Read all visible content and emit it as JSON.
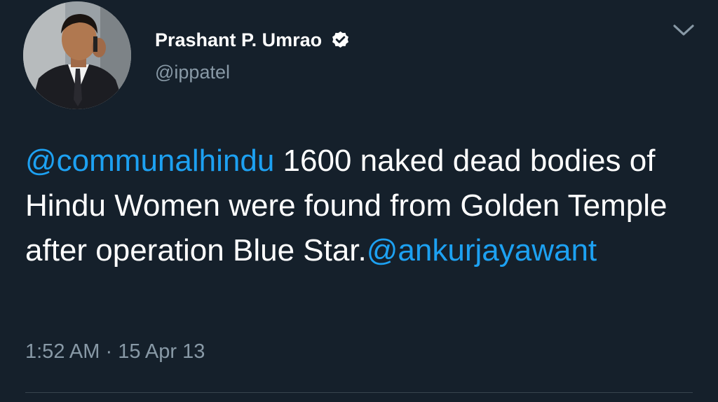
{
  "tweet": {
    "author": {
      "display_name": "Prashant P. Umrao",
      "handle": "@ippatel",
      "verified": true,
      "avatar_icon": "profile-photo-icon"
    },
    "menu_icon": "chevron-down-icon",
    "text": {
      "mention_start": "@communalhindu",
      "body_line_1": " 1600 naked dead",
      "body_rest": "bodies of Hindu Women were found from Golden Temple after operation Blue Star.",
      "mention_end": "@ankurjayawant"
    },
    "time": "1:52 AM",
    "separator": "·",
    "date": "15 Apr 13"
  },
  "colors": {
    "background": "#15202b",
    "text": "#ffffff",
    "secondary_text": "#8899a6",
    "link": "#1da1f2",
    "divider": "#38444d"
  }
}
